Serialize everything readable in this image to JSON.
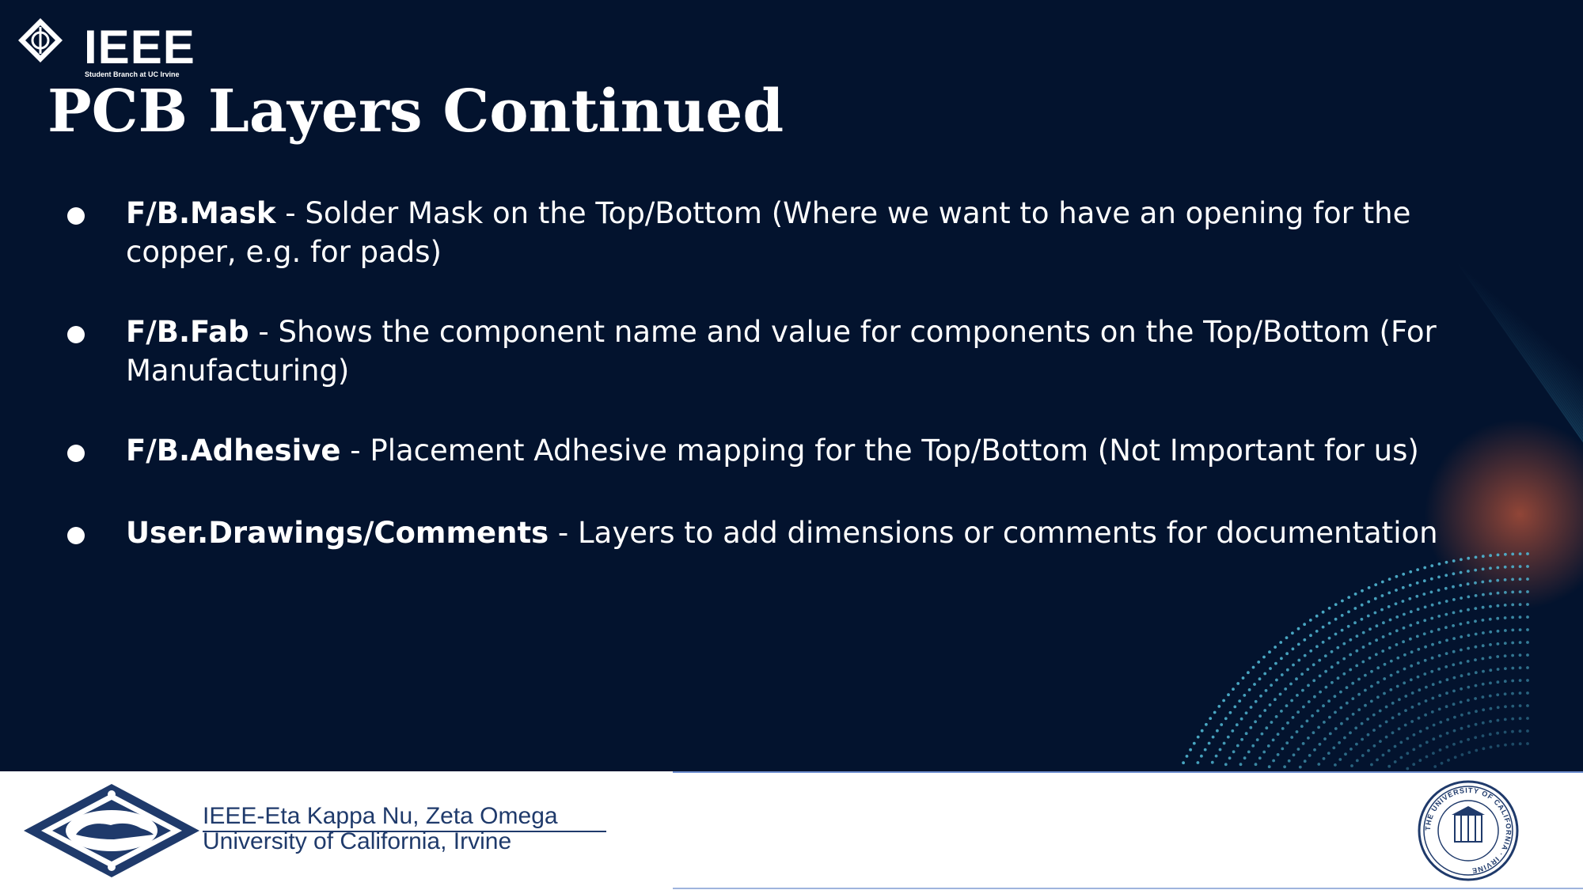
{
  "branding": {
    "logo_text": "IEEE",
    "logo_subtext": "Student Branch at UC Irvine"
  },
  "slide": {
    "title": "PCB Layers Continued"
  },
  "bullets": [
    {
      "term": "F/B.Mask",
      "text": " - Solder Mask on the Top/Bottom (Where we want to have an opening for the copper, e.g. for pads)"
    },
    {
      "term": "F/B.Fab",
      "text": " - Shows the component name and value for components on the Top/Bottom (For Manufacturing)"
    },
    {
      "term": "F/B.Adhesive",
      "text": " - Placement Adhesive mapping for the Top/Bottom (Not Important for us)"
    },
    {
      "term": "User.Drawings/Comments",
      "text": " - Layers to add dimensions or comments for documentation"
    }
  ],
  "footer": {
    "org_line1": "IEEE-Eta Kappa Nu, Zeta Omega",
    "org_line2": "University of California, Irvine",
    "seal_text": "THE UNIVERSITY OF CALIFORNIA · IRVINE"
  },
  "colors": {
    "background": "#03132e",
    "text": "#ffffff",
    "footer_text": "#1f3a6b",
    "accent_teal": "#4fb3cf"
  }
}
